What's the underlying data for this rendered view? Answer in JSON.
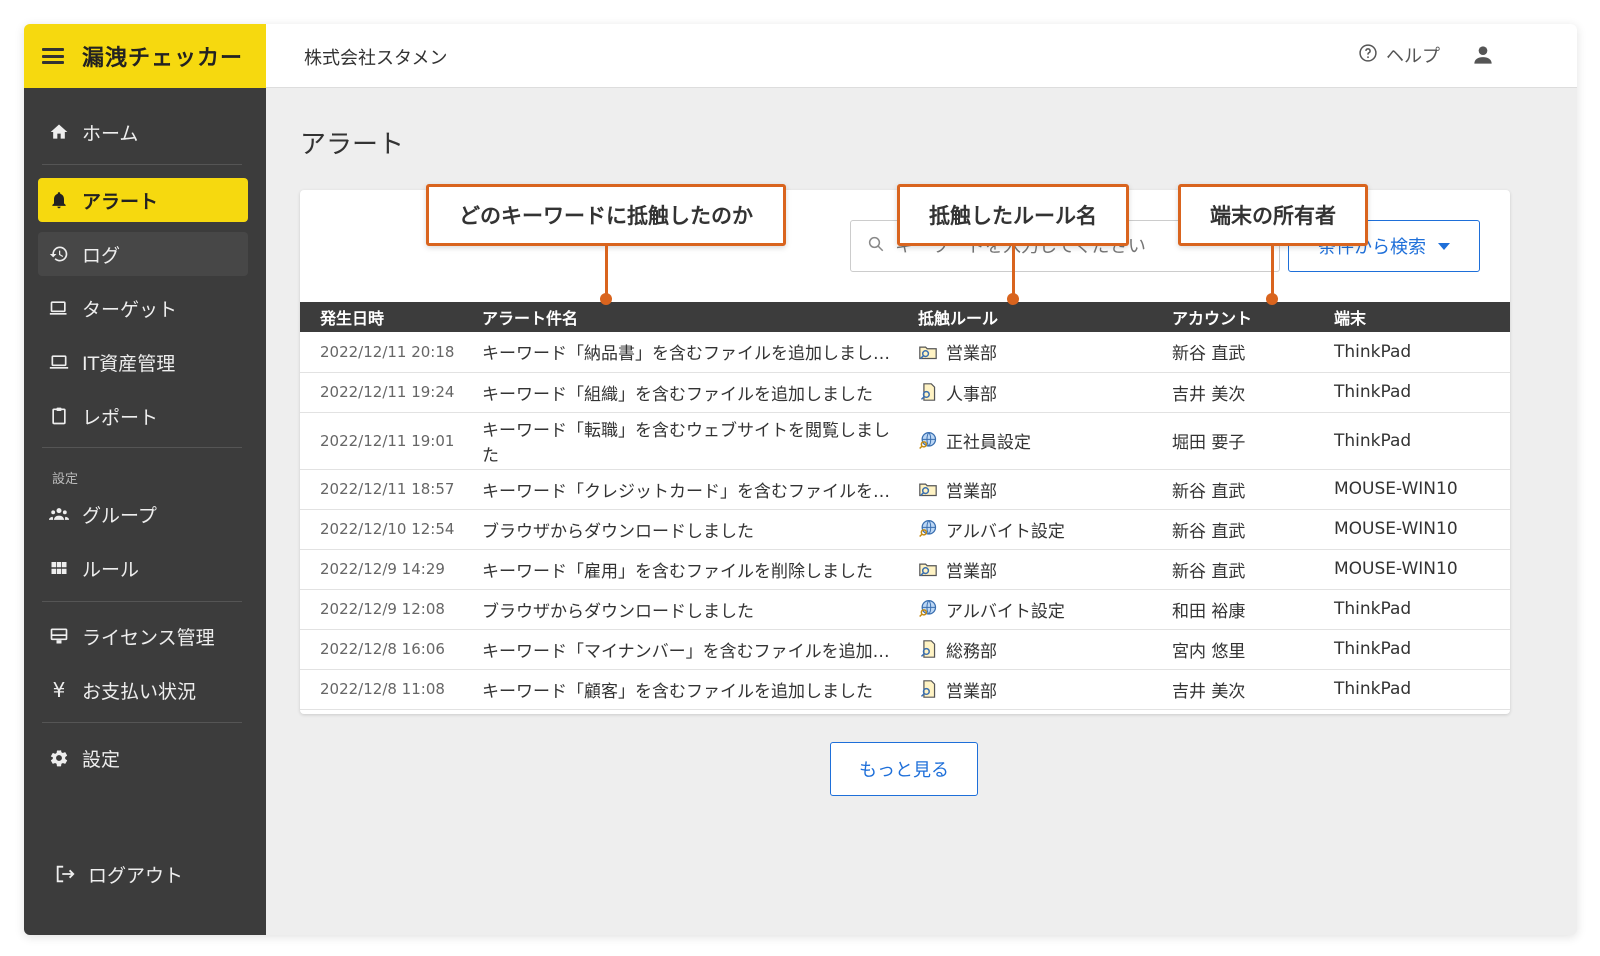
{
  "brand": {
    "title": "漏洩チェッカー"
  },
  "sidebar": {
    "items": [
      {
        "label": "ホーム"
      },
      {
        "label": "アラート"
      },
      {
        "label": "ログ"
      },
      {
        "label": "ターゲット"
      },
      {
        "label": "IT資産管理"
      },
      {
        "label": "レポート"
      },
      {
        "label": "グループ"
      },
      {
        "label": "ルール"
      },
      {
        "label": "ライセンス管理"
      },
      {
        "label": "お支払い状況"
      },
      {
        "label": "設定"
      }
    ],
    "section_label": "設定",
    "logout_label": "ログアウト"
  },
  "header": {
    "company": "株式会社スタメン",
    "help_label": "ヘルプ"
  },
  "main": {
    "title": "アラート",
    "search_placeholder": "キーワードを入力してください",
    "filter_label": "条件から検索",
    "more_label": "もっと見る",
    "columns": [
      "発生日時",
      "アラート件名",
      "抵触ルール",
      "アカウント",
      "端末"
    ],
    "rows": [
      {
        "date": "2022/12/11 20:18",
        "subject": "キーワード「納品書」を含むファイルを追加しまし…",
        "rule": "営業部",
        "rule_icon": "folder-search-icon",
        "account": "新谷 直武",
        "device": "ThinkPad"
      },
      {
        "date": "2022/12/11 19:24",
        "subject": "キーワード「組織」を含むファイルを追加しました",
        "rule": "人事部",
        "rule_icon": "file-search-icon",
        "account": "吉井 美次",
        "device": "ThinkPad"
      },
      {
        "date": "2022/12/11 19:01",
        "subject": "キーワード「転職」を含むウェブサイトを閲覧しました",
        "rule": "正社員設定",
        "rule_icon": "globe-search-icon",
        "account": "堀田 要子",
        "device": "ThinkPad"
      },
      {
        "date": "2022/12/11 18:57",
        "subject": "キーワード「クレジットカード」を含むファイルを…",
        "rule": "営業部",
        "rule_icon": "folder-search-icon",
        "account": "新谷 直武",
        "device": "MOUSE-WIN10"
      },
      {
        "date": "2022/12/10 12:54",
        "subject": "ブラウザからダウンロードしました",
        "rule": "アルバイト設定",
        "rule_icon": "globe-search-icon",
        "account": "新谷 直武",
        "device": "MOUSE-WIN10"
      },
      {
        "date": "2022/12/9 14:29",
        "subject": "キーワード「雇用」を含むファイルを削除しました",
        "rule": "営業部",
        "rule_icon": "folder-search-icon",
        "account": "新谷 直武",
        "device": "MOUSE-WIN10"
      },
      {
        "date": "2022/12/9 12:08",
        "subject": "ブラウザからダウンロードしました",
        "rule": "アルバイト設定",
        "rule_icon": "globe-search-icon",
        "account": "和田 裕康",
        "device": "ThinkPad"
      },
      {
        "date": "2022/12/8 16:06",
        "subject": "キーワード「マイナンバー」を含むファイルを追加…",
        "rule": "総務部",
        "rule_icon": "file-search-icon",
        "account": "宮内 悠里",
        "device": "ThinkPad"
      },
      {
        "date": "2022/12/8 11:08",
        "subject": "キーワード「顧客」を含むファイルを追加しました",
        "rule": "営業部",
        "rule_icon": "file-search-icon",
        "account": "吉井 美次",
        "device": "ThinkPad"
      }
    ]
  },
  "callouts": {
    "keyword": "どのキーワードに抵触したのか",
    "rule": "抵触したルール名",
    "owner": "端末の所有者"
  },
  "colors": {
    "brand_yellow": "#f6d90f",
    "sidebar_dark": "#3c3c3c",
    "accent_blue": "#1e6fd9",
    "callout_orange": "#d9641e"
  }
}
